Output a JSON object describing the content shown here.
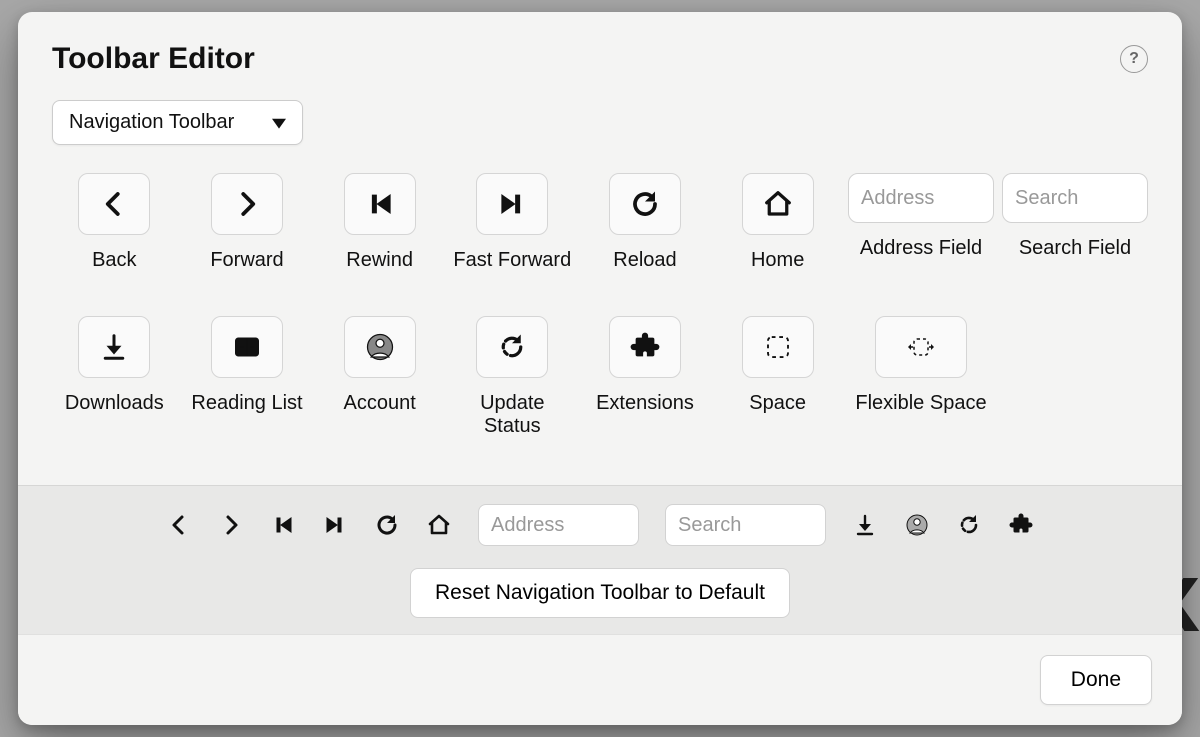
{
  "header": {
    "title": "Toolbar Editor",
    "help_tooltip": "?"
  },
  "selector": {
    "current": "Navigation Toolbar"
  },
  "palette": {
    "row1": [
      {
        "id": "back",
        "label": "Back",
        "icon": "chevron-left"
      },
      {
        "id": "forward",
        "label": "Forward",
        "icon": "chevron-right"
      },
      {
        "id": "rewind",
        "label": "Rewind",
        "icon": "skip-back"
      },
      {
        "id": "fast-forward",
        "label": "Fast Forward",
        "icon": "skip-forward"
      },
      {
        "id": "reload",
        "label": "Reload",
        "icon": "reload"
      },
      {
        "id": "home",
        "label": "Home",
        "icon": "home"
      },
      {
        "id": "address-field",
        "label": "Address Field",
        "placeholder": "Address",
        "kind": "field"
      },
      {
        "id": "search-field",
        "label": "Search Field",
        "placeholder": "Search",
        "kind": "field"
      }
    ],
    "row2": [
      {
        "id": "downloads",
        "label": "Downloads",
        "icon": "download"
      },
      {
        "id": "reading-list",
        "label": "Reading List",
        "icon": "book"
      },
      {
        "id": "account",
        "label": "Account",
        "icon": "account"
      },
      {
        "id": "update-status",
        "label": "Update Status",
        "icon": "update"
      },
      {
        "id": "extensions",
        "label": "Extensions",
        "icon": "puzzle"
      },
      {
        "id": "space",
        "label": "Space",
        "icon": "space"
      },
      {
        "id": "flexible-space",
        "label": "Flexible Space",
        "icon": "flex-space"
      }
    ]
  },
  "preview": {
    "items": [
      {
        "id": "back",
        "icon": "chevron-left"
      },
      {
        "id": "forward",
        "icon": "chevron-right"
      },
      {
        "id": "rewind",
        "icon": "skip-back"
      },
      {
        "id": "fast-forward",
        "icon": "skip-forward"
      },
      {
        "id": "reload",
        "icon": "reload"
      },
      {
        "id": "home",
        "icon": "home"
      },
      {
        "id": "address-field",
        "placeholder": "Address",
        "width": 155,
        "kind": "field"
      },
      {
        "id": "search-field",
        "placeholder": "Search",
        "width": 155,
        "kind": "field"
      },
      {
        "id": "downloads",
        "icon": "download"
      },
      {
        "id": "account",
        "icon": "account"
      },
      {
        "id": "update-status",
        "icon": "update"
      },
      {
        "id": "extensions",
        "icon": "puzzle"
      }
    ],
    "reset_label": "Reset Navigation Toolbar to Default"
  },
  "footer": {
    "done_label": "Done"
  }
}
